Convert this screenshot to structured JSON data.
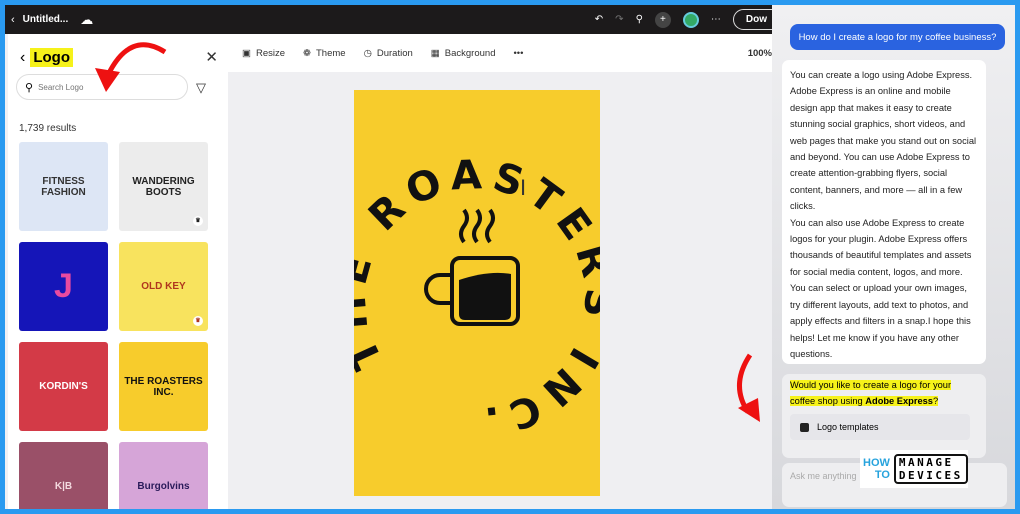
{
  "topbar": {
    "back_icon": "chevron-left",
    "title": "Untitled...",
    "download_label": "Dow"
  },
  "left_panel": {
    "title": "Logo",
    "search_placeholder": "Search Logo",
    "results_count": "1,739 results",
    "templates": [
      {
        "name": "FITNESS FASHION",
        "bg": "#dde6f5",
        "fg": "#333"
      },
      {
        "name": "WANDERING BOOTS",
        "bg": "#ececec",
        "fg": "#222"
      },
      {
        "name": "J",
        "bg": "#1515b8",
        "fg": "#e84aa0"
      },
      {
        "name": "OLD KEY",
        "bg": "#f8e35e",
        "fg": "#b0361e"
      },
      {
        "name": "KORDIN'S",
        "bg": "#d33a47",
        "fg": "#fff"
      },
      {
        "name": "THE ROASTERS INC.",
        "bg": "#f7cc2c",
        "fg": "#111"
      },
      {
        "name": "K|B",
        "bg": "#9a5068",
        "fg": "#f3d9df"
      },
      {
        "name": "Burgolvins",
        "bg": "#d6a5d8",
        "fg": "#2a1b5a"
      }
    ]
  },
  "toolbar": {
    "resize": "Resize",
    "theme": "Theme",
    "duration": "Duration",
    "background": "Background",
    "more": "•••",
    "zoom": "100%"
  },
  "canvas": {
    "logo_text": "THE ROASTERS INC.",
    "bg": "#f7cc2c"
  },
  "chat": {
    "user_message": "How do I create a logo for my coffee business?",
    "assistant_p1": "You can create a logo using Adobe Express. Adobe Express is an online and mobile design app that makes it easy to create stunning social graphics, short videos, and web pages that make you stand out on social and beyond. You can use Adobe Express to create attention-grabbing flyers, social content, banners, and more — all in a few clicks.",
    "assistant_p2": "You can also use Adobe Express to create logos for your plugin. Adobe Express offers thousands of beautiful templates and assets for social media content, logos, and more. You can select or upload your own images, try different layouts, add text to photos, and apply effects and filters in a snap.I hope this helps! Let me know if you have any other questions.",
    "question_pre": "Would you like to create a logo for your coffee shop using ",
    "question_bold": "Adobe Express",
    "question_post": "?",
    "logo_templates_button": "Logo templates",
    "input_placeholder": "Ask me anything"
  },
  "watermark": {
    "how": "HOW",
    "to": "TO",
    "manage": "MANAGE",
    "devices": "DEVICES"
  }
}
